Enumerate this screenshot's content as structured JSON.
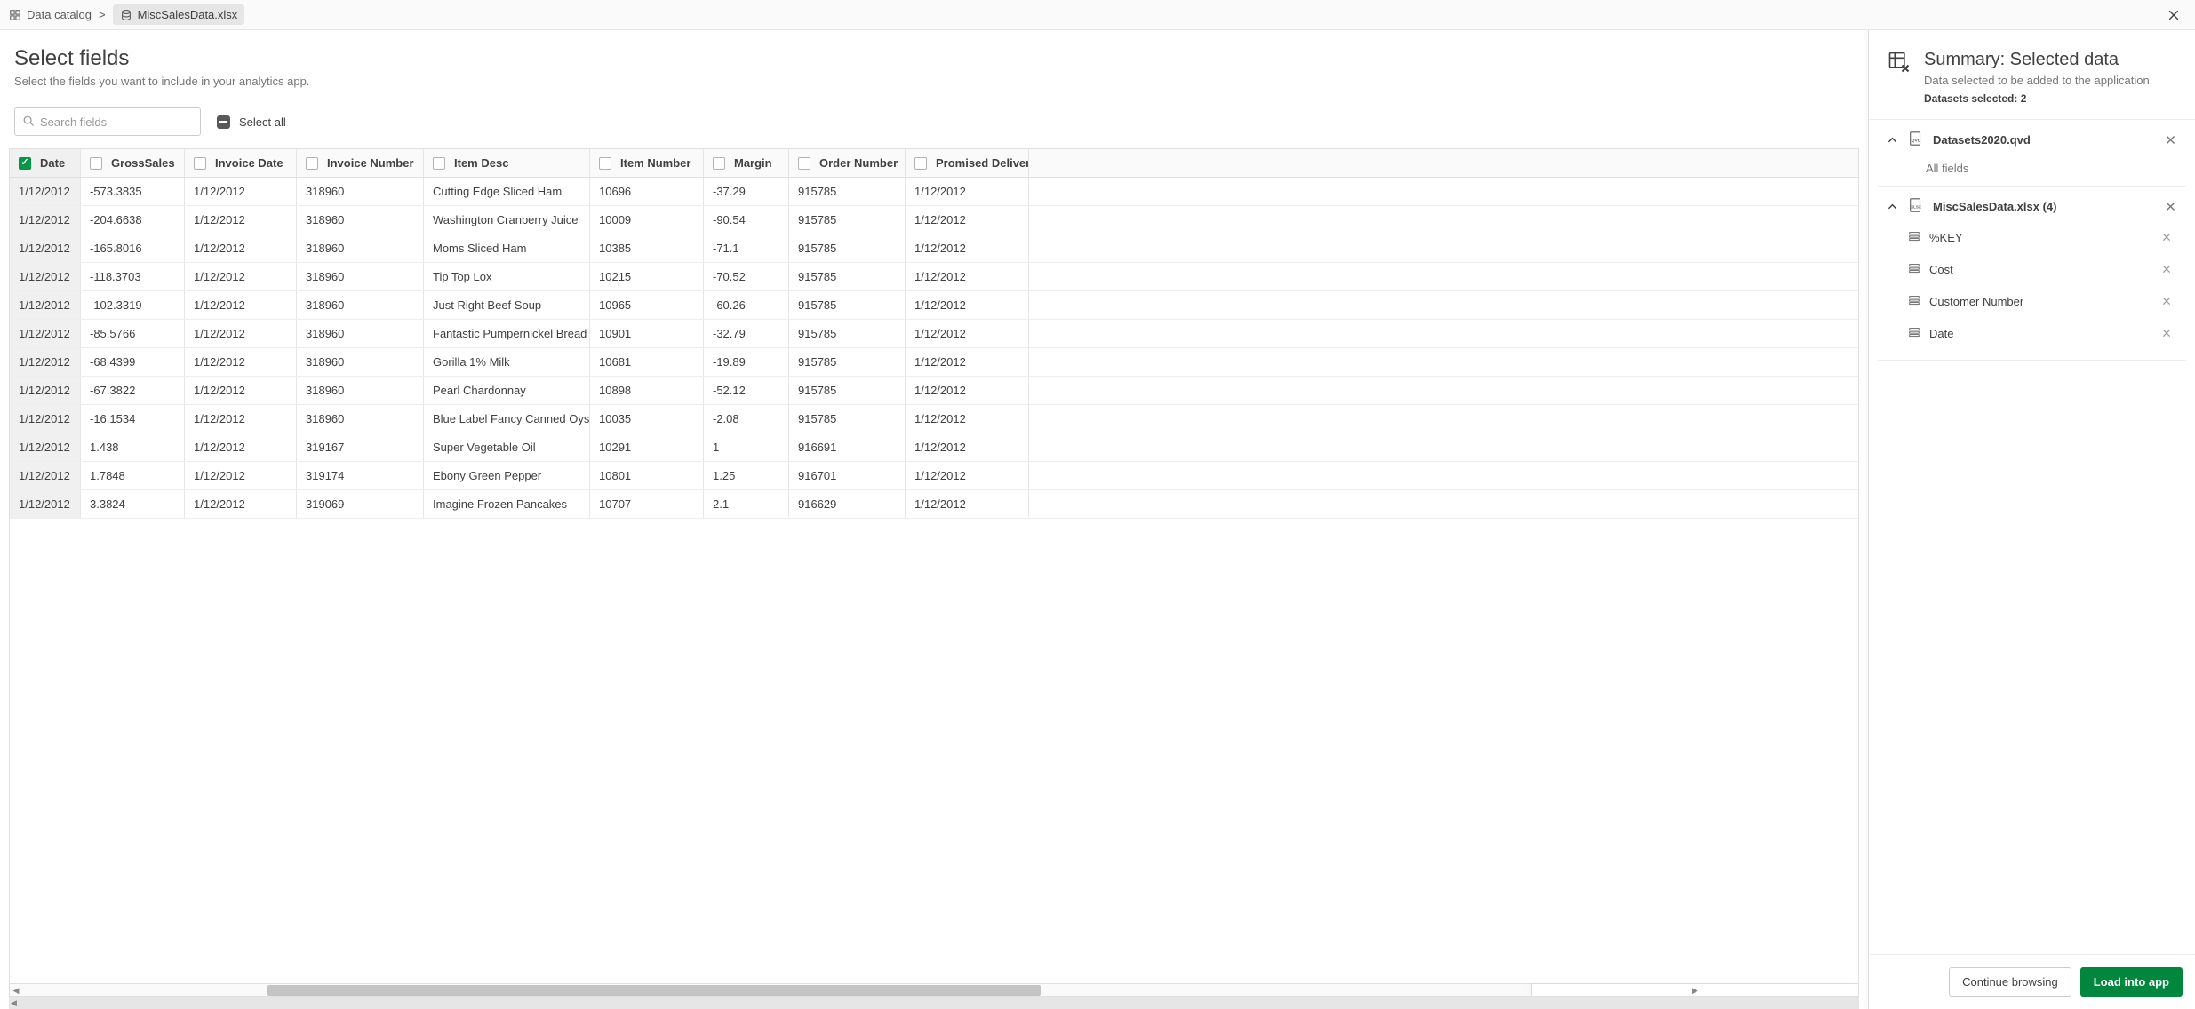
{
  "breadcrumb": {
    "root": "Data catalog",
    "current": "MiscSalesData.xlsx"
  },
  "header": {
    "title": "Select fields",
    "subtitle": "Select the fields you want to include in your analytics app."
  },
  "controls": {
    "search_placeholder": "Search fields",
    "select_all_label": "Select all"
  },
  "table": {
    "columns": [
      {
        "label": "Date",
        "checked": true
      },
      {
        "label": "GrossSales",
        "checked": false
      },
      {
        "label": "Invoice Date",
        "checked": false
      },
      {
        "label": "Invoice Number",
        "checked": false
      },
      {
        "label": "Item Desc",
        "checked": false
      },
      {
        "label": "Item Number",
        "checked": false
      },
      {
        "label": "Margin",
        "checked": false
      },
      {
        "label": "Order Number",
        "checked": false
      },
      {
        "label": "Promised Delivery Date",
        "checked": false
      }
    ],
    "rows": [
      [
        "1/12/2012",
        "-573.3835",
        "1/12/2012",
        "318960",
        "Cutting Edge Sliced Ham",
        "10696",
        "-37.29",
        "915785",
        "1/12/2012"
      ],
      [
        "1/12/2012",
        "-204.6638",
        "1/12/2012",
        "318960",
        "Washington Cranberry Juice",
        "10009",
        "-90.54",
        "915785",
        "1/12/2012"
      ],
      [
        "1/12/2012",
        "-165.8016",
        "1/12/2012",
        "318960",
        "Moms Sliced Ham",
        "10385",
        "-71.1",
        "915785",
        "1/12/2012"
      ],
      [
        "1/12/2012",
        "-118.3703",
        "1/12/2012",
        "318960",
        "Tip Top Lox",
        "10215",
        "-70.52",
        "915785",
        "1/12/2012"
      ],
      [
        "1/12/2012",
        "-102.3319",
        "1/12/2012",
        "318960",
        "Just Right Beef Soup",
        "10965",
        "-60.26",
        "915785",
        "1/12/2012"
      ],
      [
        "1/12/2012",
        "-85.5766",
        "1/12/2012",
        "318960",
        "Fantastic Pumpernickel Bread",
        "10901",
        "-32.79",
        "915785",
        "1/12/2012"
      ],
      [
        "1/12/2012",
        "-68.4399",
        "1/12/2012",
        "318960",
        "Gorilla 1% Milk",
        "10681",
        "-19.89",
        "915785",
        "1/12/2012"
      ],
      [
        "1/12/2012",
        "-67.3822",
        "1/12/2012",
        "318960",
        "Pearl Chardonnay",
        "10898",
        "-52.12",
        "915785",
        "1/12/2012"
      ],
      [
        "1/12/2012",
        "-16.1534",
        "1/12/2012",
        "318960",
        "Blue Label Fancy Canned Oysters",
        "10035",
        "-2.08",
        "915785",
        "1/12/2012"
      ],
      [
        "1/12/2012",
        "1.438",
        "1/12/2012",
        "319167",
        "Super Vegetable Oil",
        "10291",
        "1",
        "916691",
        "1/12/2012"
      ],
      [
        "1/12/2012",
        "1.7848",
        "1/12/2012",
        "319174",
        "Ebony Green Pepper",
        "10801",
        "1.25",
        "916701",
        "1/12/2012"
      ],
      [
        "1/12/2012",
        "3.3824",
        "1/12/2012",
        "319069",
        "Imagine Frozen Pancakes",
        "10707",
        "2.1",
        "916629",
        "1/12/2012"
      ]
    ]
  },
  "summary": {
    "title": "Summary: Selected data",
    "subtitle": "Data selected to be added to the application.",
    "datasets_selected_label": "Datasets selected: 2",
    "continue_label": "Continue browsing",
    "load_label": "Load into app",
    "datasets": [
      {
        "name": "Datasets2020.qvd",
        "type": "qvd",
        "expanded": true,
        "all_fields_label": "All fields",
        "fields": []
      },
      {
        "name": "MiscSalesData.xlsx (4)",
        "type": "xlsx",
        "expanded": true,
        "fields": [
          "%KEY",
          "Cost",
          "Customer Number",
          "Date"
        ]
      }
    ]
  }
}
